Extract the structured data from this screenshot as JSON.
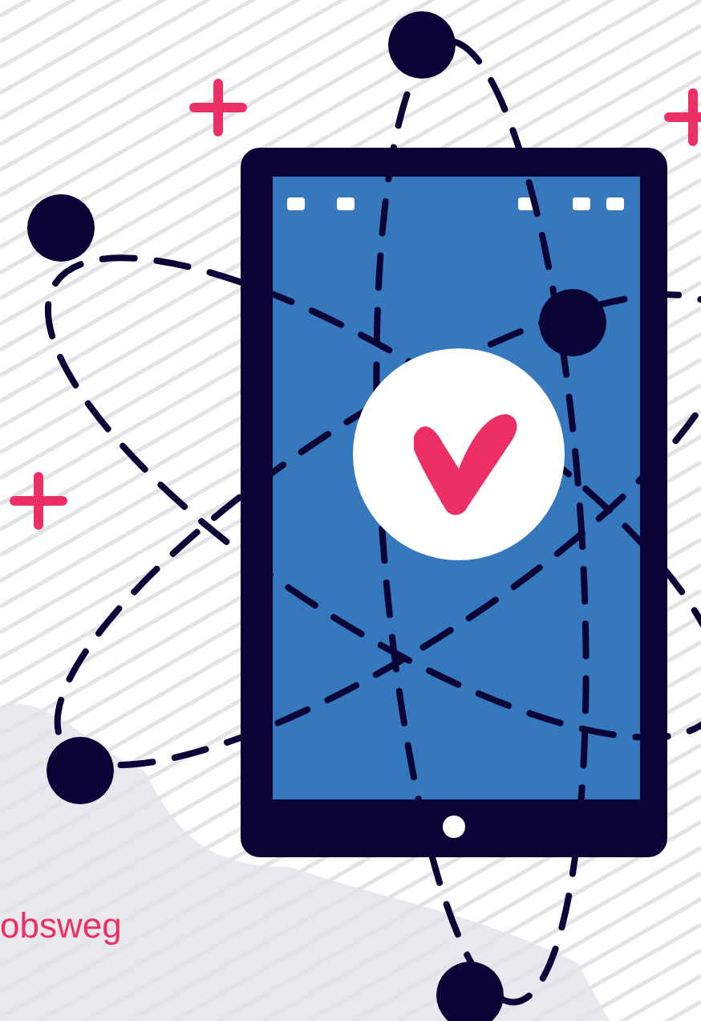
{
  "hero": {
    "link_text": "obsweg"
  }
}
